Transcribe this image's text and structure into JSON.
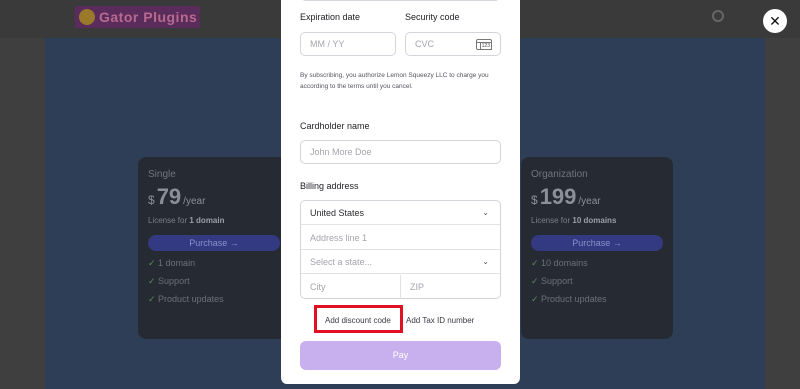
{
  "background": {
    "logo_text": "Gator Plugins",
    "cards": [
      {
        "plan": "Single",
        "currency": "$",
        "price": "79",
        "period": "/year",
        "license_prefix": "License for",
        "license_bold": "1 domain",
        "buy": "Purchase →",
        "features": [
          "1 domain",
          "Support",
          "Product updates"
        ]
      },
      {
        "plan": "Organization",
        "currency": "$",
        "price": "199",
        "period": "/year",
        "license_prefix": "License for",
        "license_bold": "10 domains",
        "buy": "Purchase →",
        "features": [
          "10 domains",
          "Support",
          "Product updates"
        ]
      }
    ]
  },
  "close_icon": "✕",
  "form": {
    "expiration_label": "Expiration date",
    "expiration_placeholder": "MM / YY",
    "security_label": "Security code",
    "security_placeholder": "CVC",
    "terms_text": "By subscribing, you authorize Lemon Squeezy LLC to charge you according to the terms until you cancel.",
    "cardholder_label": "Cardholder name",
    "cardholder_placeholder": "John More Doe",
    "billing_label": "Billing address",
    "country_value": "United States",
    "address_placeholder": "Address line 1",
    "state_placeholder": "Select a state...",
    "city_placeholder": "City",
    "zip_placeholder": "ZIP",
    "discount_link": "Add discount code",
    "tax_link": "Add Tax ID number",
    "pay_button": "Pay"
  },
  "colors": {
    "pay_button": "#c8b0ef",
    "highlight_box": "#e10f22",
    "background_overlay": "#3f3f3f"
  }
}
